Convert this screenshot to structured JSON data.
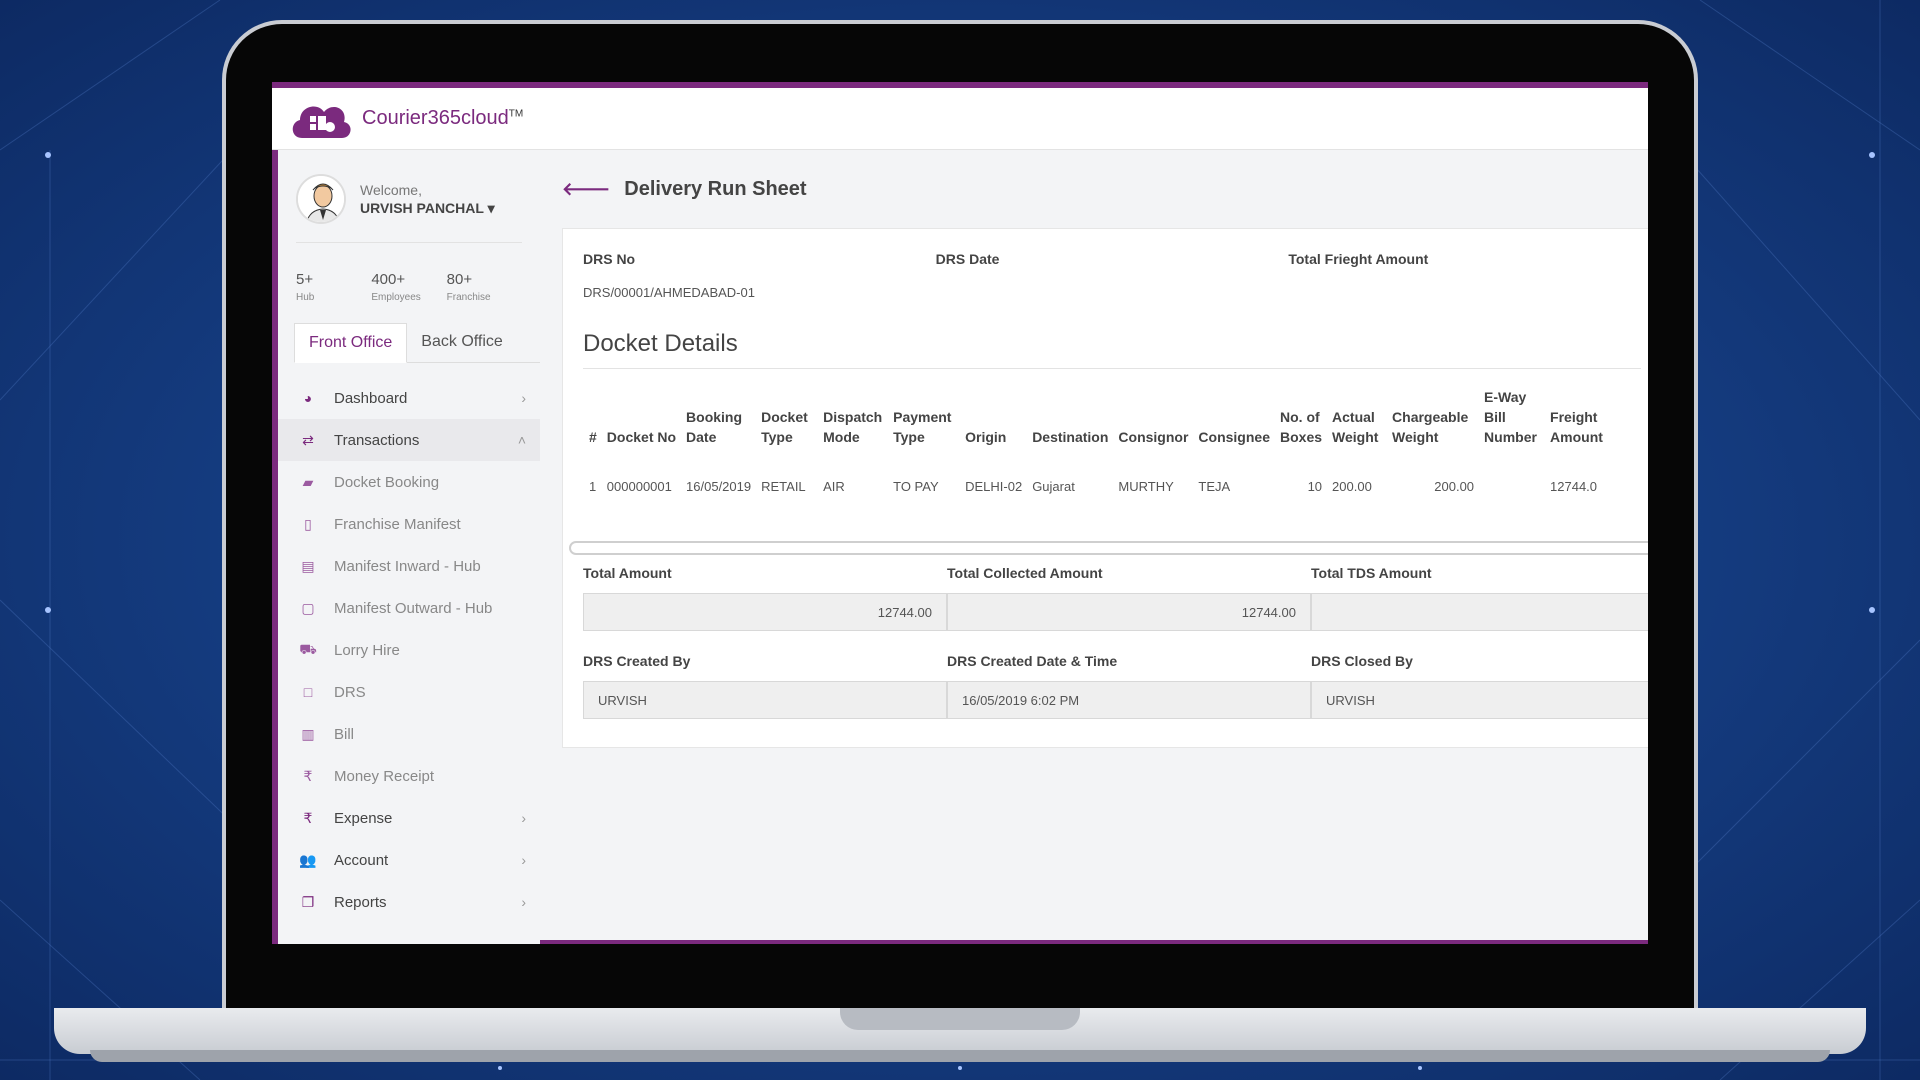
{
  "brand": {
    "name": "Courier365cloud",
    "tm": "TM"
  },
  "profile": {
    "welcome": "Welcome,",
    "user": "URVISH PANCHAL ▾"
  },
  "stats": [
    {
      "value": "5+",
      "label": "Hub"
    },
    {
      "value": "400+",
      "label": "Employees"
    },
    {
      "value": "80+",
      "label": "Franchise"
    }
  ],
  "tabs": {
    "front": "Front Office",
    "back": "Back Office"
  },
  "menu": [
    {
      "label": "Dashboard",
      "icon": "dashboard-icon"
    },
    {
      "label": "Transactions",
      "icon": "transfer-icon"
    },
    {
      "label": "Docket Booking",
      "icon": "book-icon"
    },
    {
      "label": "Franchise Manifest",
      "icon": "bookmark-icon"
    },
    {
      "label": "Manifest Inward - Hub",
      "icon": "file-icon"
    },
    {
      "label": "Manifest Outward - Hub",
      "icon": "file-outline-icon"
    },
    {
      "label": "Lorry Hire",
      "icon": "truck-icon"
    },
    {
      "label": "DRS",
      "icon": "square-icon"
    },
    {
      "label": "Bill",
      "icon": "bill-icon"
    },
    {
      "label": "Money Receipt",
      "icon": "rupee-icon"
    },
    {
      "label": "Expense",
      "icon": "rupee-icon"
    },
    {
      "label": "Account",
      "icon": "users-icon"
    },
    {
      "label": "Reports",
      "icon": "copy-icon"
    }
  ],
  "page": {
    "title": "Delivery Run Sheet"
  },
  "summary": {
    "drs_no_label": "DRS No",
    "drs_no_value": "DRS/00001/AHMEDABAD-01",
    "drs_date_label": "DRS Date",
    "freight_label": "Total Frieght Amount"
  },
  "docket": {
    "title": "Docket Details",
    "headers": [
      "#",
      "Docket No",
      "Booking Date",
      "Docket Type",
      "Dispatch Mode",
      "Payment Type",
      "Origin",
      "Destination",
      "Consignor",
      "Consignee",
      "No. of Boxes",
      "Actual Weight",
      "Chargeable Weight",
      "E-Way Bill Number",
      "Freight Amount"
    ],
    "row": [
      "1",
      "000000001",
      "16/05/2019",
      "RETAIL",
      "AIR",
      "TO PAY",
      "DELHI-02",
      "Gujarat",
      "MURTHY",
      "TEJA",
      "10",
      "200.00",
      "200.00",
      "",
      "12744.0"
    ]
  },
  "fields": {
    "total_amount_label": "Total Amount",
    "total_amount": "12744.00",
    "collected_label": "Total Collected Amount",
    "collected": "12744.00",
    "tds_label": "Total TDS Amount",
    "tds": "",
    "created_by_label": "DRS Created By",
    "created_by": "URVISH",
    "created_dt_label": "DRS Created Date & Time",
    "created_dt": "16/05/2019 6:02 PM",
    "closed_by_label": "DRS Closed By",
    "closed_by": "URVISH"
  }
}
